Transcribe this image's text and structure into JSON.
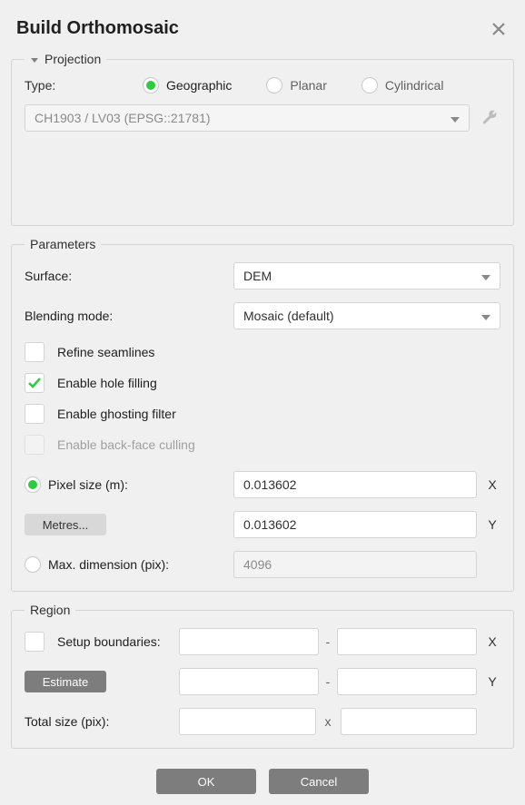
{
  "title": "Build Orthomosaic",
  "projection": {
    "legend": "Projection",
    "type_label": "Type:",
    "geographic": "Geographic",
    "planar": "Planar",
    "cylindrical": "Cylindrical",
    "crs": "CH1903 / LV03 (EPSG::21781)"
  },
  "parameters": {
    "legend": "Parameters",
    "surface_label": "Surface:",
    "surface_value": "DEM",
    "blending_label": "Blending mode:",
    "blending_value": "Mosaic (default)",
    "refine_seamlines": "Refine seamlines",
    "enable_hole_filling": "Enable hole filling",
    "enable_ghosting": "Enable ghosting filter",
    "enable_backface": "Enable back-face culling",
    "pixel_size_label": "Pixel size (m):",
    "pixel_size_x": "0.013602",
    "pixel_size_y": "0.013602",
    "metres_btn": "Metres...",
    "max_dim_label": "Max. dimension (pix):",
    "max_dim_value": "4096",
    "axis_x": "X",
    "axis_y": "Y"
  },
  "region": {
    "legend": "Region",
    "setup_boundaries": "Setup boundaries:",
    "estimate_btn": "Estimate",
    "total_size": "Total size (pix):",
    "axis_x": "X",
    "axis_y": "Y",
    "dash": "-",
    "times": "x"
  },
  "buttons": {
    "ok": "OK",
    "cancel": "Cancel"
  },
  "icons": {
    "close": "close-icon",
    "wrench": "wrench-icon",
    "caret": "chevron-down-icon",
    "arrow": "triangle-down-icon"
  }
}
